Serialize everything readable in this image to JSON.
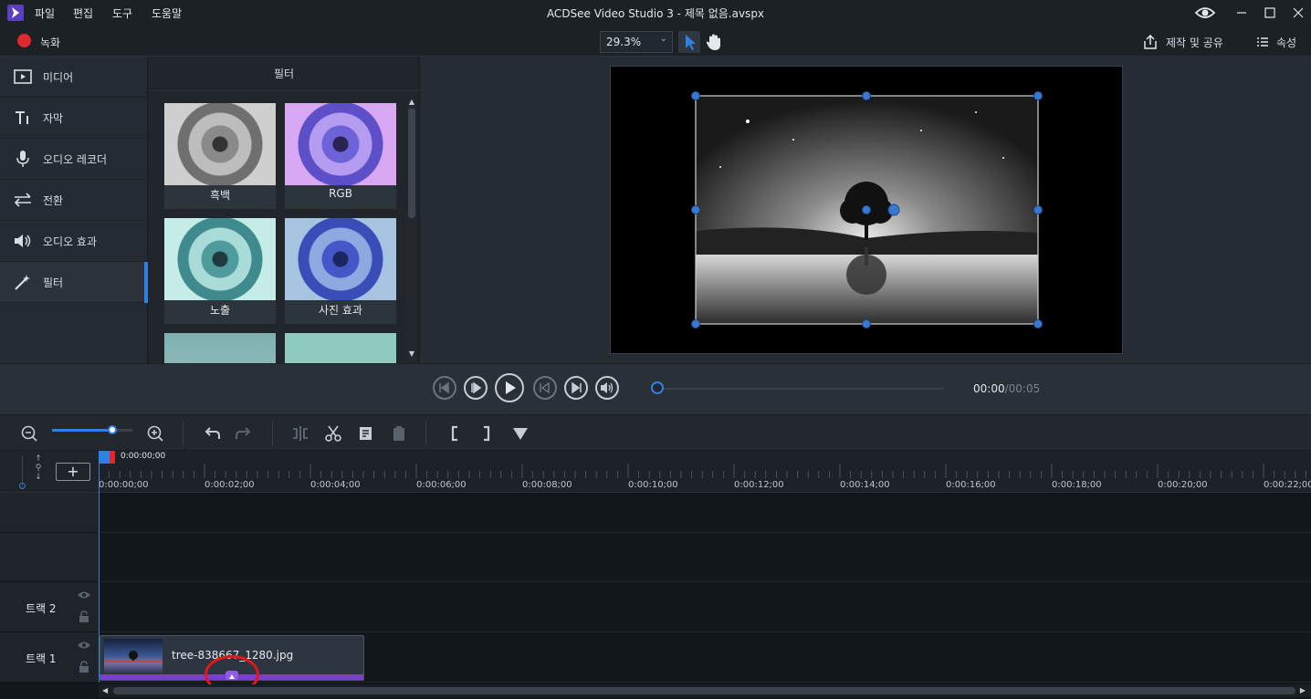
{
  "titlebar": {
    "title": "ACDSee Video Studio 3 - 제목 없음.avspx",
    "menu": [
      "파일",
      "편집",
      "도구",
      "도움말"
    ]
  },
  "toolbar": {
    "record_label": "녹화",
    "zoom_value": "29.3%",
    "share_label": "제작 및 공유",
    "properties_label": "속성"
  },
  "sidebar": {
    "items": [
      {
        "label": "미디어",
        "icon": "media-icon"
      },
      {
        "label": "자막",
        "icon": "text-icon"
      },
      {
        "label": "오디오 레코더",
        "icon": "microphone-icon"
      },
      {
        "label": "전환",
        "icon": "transition-icon"
      },
      {
        "label": "오디오 효과",
        "icon": "speaker-icon"
      },
      {
        "label": "필터",
        "icon": "magic-wand-icon",
        "active": true
      }
    ]
  },
  "filter_panel": {
    "title": "필터",
    "filters": [
      {
        "label": "흑백"
      },
      {
        "label": "RGB"
      },
      {
        "label": "노출"
      },
      {
        "label": "사진 효과"
      },
      {
        "label": ""
      },
      {
        "label": ""
      }
    ]
  },
  "transport": {
    "current_time": "00:00",
    "separator": "/",
    "total_time": "00:05",
    "progress": 0
  },
  "timeline": {
    "playhead_time": "0:00:00;00",
    "ticks": [
      "0:00:00;00",
      "0:00:02;00",
      "0:00:04;00",
      "0:00:06;00",
      "0:00:08;00",
      "0:00:10;00",
      "0:00:12;00",
      "0:00:14;00",
      "0:00:16;00",
      "0:00:18;00",
      "0:00:20;00",
      "0:00:22;00"
    ],
    "tracks": [
      {
        "label": "트랙 2"
      },
      {
        "label": "트랙 1"
      }
    ],
    "clip": {
      "name": "tree-838667_1280.jpg"
    }
  },
  "colors": {
    "accent": "#2f80e4",
    "record": "#e0282e",
    "clip_stripe": "#7b3fd0",
    "annotation": "#e01818"
  }
}
